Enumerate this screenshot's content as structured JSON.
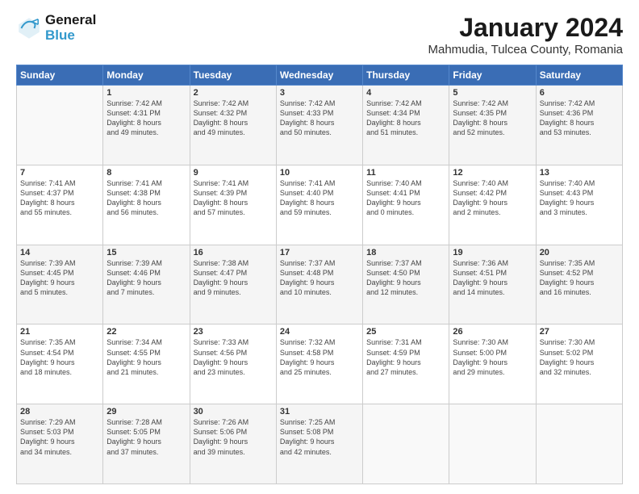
{
  "header": {
    "logo_line1": "General",
    "logo_line2": "Blue",
    "title": "January 2024",
    "subtitle": "Mahmudia, Tulcea County, Romania"
  },
  "weekdays": [
    "Sunday",
    "Monday",
    "Tuesday",
    "Wednesday",
    "Thursday",
    "Friday",
    "Saturday"
  ],
  "weeks": [
    [
      {
        "day": "",
        "info": ""
      },
      {
        "day": "1",
        "info": "Sunrise: 7:42 AM\nSunset: 4:31 PM\nDaylight: 8 hours\nand 49 minutes."
      },
      {
        "day": "2",
        "info": "Sunrise: 7:42 AM\nSunset: 4:32 PM\nDaylight: 8 hours\nand 49 minutes."
      },
      {
        "day": "3",
        "info": "Sunrise: 7:42 AM\nSunset: 4:33 PM\nDaylight: 8 hours\nand 50 minutes."
      },
      {
        "day": "4",
        "info": "Sunrise: 7:42 AM\nSunset: 4:34 PM\nDaylight: 8 hours\nand 51 minutes."
      },
      {
        "day": "5",
        "info": "Sunrise: 7:42 AM\nSunset: 4:35 PM\nDaylight: 8 hours\nand 52 minutes."
      },
      {
        "day": "6",
        "info": "Sunrise: 7:42 AM\nSunset: 4:36 PM\nDaylight: 8 hours\nand 53 minutes."
      }
    ],
    [
      {
        "day": "7",
        "info": "Sunrise: 7:41 AM\nSunset: 4:37 PM\nDaylight: 8 hours\nand 55 minutes."
      },
      {
        "day": "8",
        "info": "Sunrise: 7:41 AM\nSunset: 4:38 PM\nDaylight: 8 hours\nand 56 minutes."
      },
      {
        "day": "9",
        "info": "Sunrise: 7:41 AM\nSunset: 4:39 PM\nDaylight: 8 hours\nand 57 minutes."
      },
      {
        "day": "10",
        "info": "Sunrise: 7:41 AM\nSunset: 4:40 PM\nDaylight: 8 hours\nand 59 minutes."
      },
      {
        "day": "11",
        "info": "Sunrise: 7:40 AM\nSunset: 4:41 PM\nDaylight: 9 hours\nand 0 minutes."
      },
      {
        "day": "12",
        "info": "Sunrise: 7:40 AM\nSunset: 4:42 PM\nDaylight: 9 hours\nand 2 minutes."
      },
      {
        "day": "13",
        "info": "Sunrise: 7:40 AM\nSunset: 4:43 PM\nDaylight: 9 hours\nand 3 minutes."
      }
    ],
    [
      {
        "day": "14",
        "info": "Sunrise: 7:39 AM\nSunset: 4:45 PM\nDaylight: 9 hours\nand 5 minutes."
      },
      {
        "day": "15",
        "info": "Sunrise: 7:39 AM\nSunset: 4:46 PM\nDaylight: 9 hours\nand 7 minutes."
      },
      {
        "day": "16",
        "info": "Sunrise: 7:38 AM\nSunset: 4:47 PM\nDaylight: 9 hours\nand 9 minutes."
      },
      {
        "day": "17",
        "info": "Sunrise: 7:37 AM\nSunset: 4:48 PM\nDaylight: 9 hours\nand 10 minutes."
      },
      {
        "day": "18",
        "info": "Sunrise: 7:37 AM\nSunset: 4:50 PM\nDaylight: 9 hours\nand 12 minutes."
      },
      {
        "day": "19",
        "info": "Sunrise: 7:36 AM\nSunset: 4:51 PM\nDaylight: 9 hours\nand 14 minutes."
      },
      {
        "day": "20",
        "info": "Sunrise: 7:35 AM\nSunset: 4:52 PM\nDaylight: 9 hours\nand 16 minutes."
      }
    ],
    [
      {
        "day": "21",
        "info": "Sunrise: 7:35 AM\nSunset: 4:54 PM\nDaylight: 9 hours\nand 18 minutes."
      },
      {
        "day": "22",
        "info": "Sunrise: 7:34 AM\nSunset: 4:55 PM\nDaylight: 9 hours\nand 21 minutes."
      },
      {
        "day": "23",
        "info": "Sunrise: 7:33 AM\nSunset: 4:56 PM\nDaylight: 9 hours\nand 23 minutes."
      },
      {
        "day": "24",
        "info": "Sunrise: 7:32 AM\nSunset: 4:58 PM\nDaylight: 9 hours\nand 25 minutes."
      },
      {
        "day": "25",
        "info": "Sunrise: 7:31 AM\nSunset: 4:59 PM\nDaylight: 9 hours\nand 27 minutes."
      },
      {
        "day": "26",
        "info": "Sunrise: 7:30 AM\nSunset: 5:00 PM\nDaylight: 9 hours\nand 29 minutes."
      },
      {
        "day": "27",
        "info": "Sunrise: 7:30 AM\nSunset: 5:02 PM\nDaylight: 9 hours\nand 32 minutes."
      }
    ],
    [
      {
        "day": "28",
        "info": "Sunrise: 7:29 AM\nSunset: 5:03 PM\nDaylight: 9 hours\nand 34 minutes."
      },
      {
        "day": "29",
        "info": "Sunrise: 7:28 AM\nSunset: 5:05 PM\nDaylight: 9 hours\nand 37 minutes."
      },
      {
        "day": "30",
        "info": "Sunrise: 7:26 AM\nSunset: 5:06 PM\nDaylight: 9 hours\nand 39 minutes."
      },
      {
        "day": "31",
        "info": "Sunrise: 7:25 AM\nSunset: 5:08 PM\nDaylight: 9 hours\nand 42 minutes."
      },
      {
        "day": "",
        "info": ""
      },
      {
        "day": "",
        "info": ""
      },
      {
        "day": "",
        "info": ""
      }
    ]
  ]
}
